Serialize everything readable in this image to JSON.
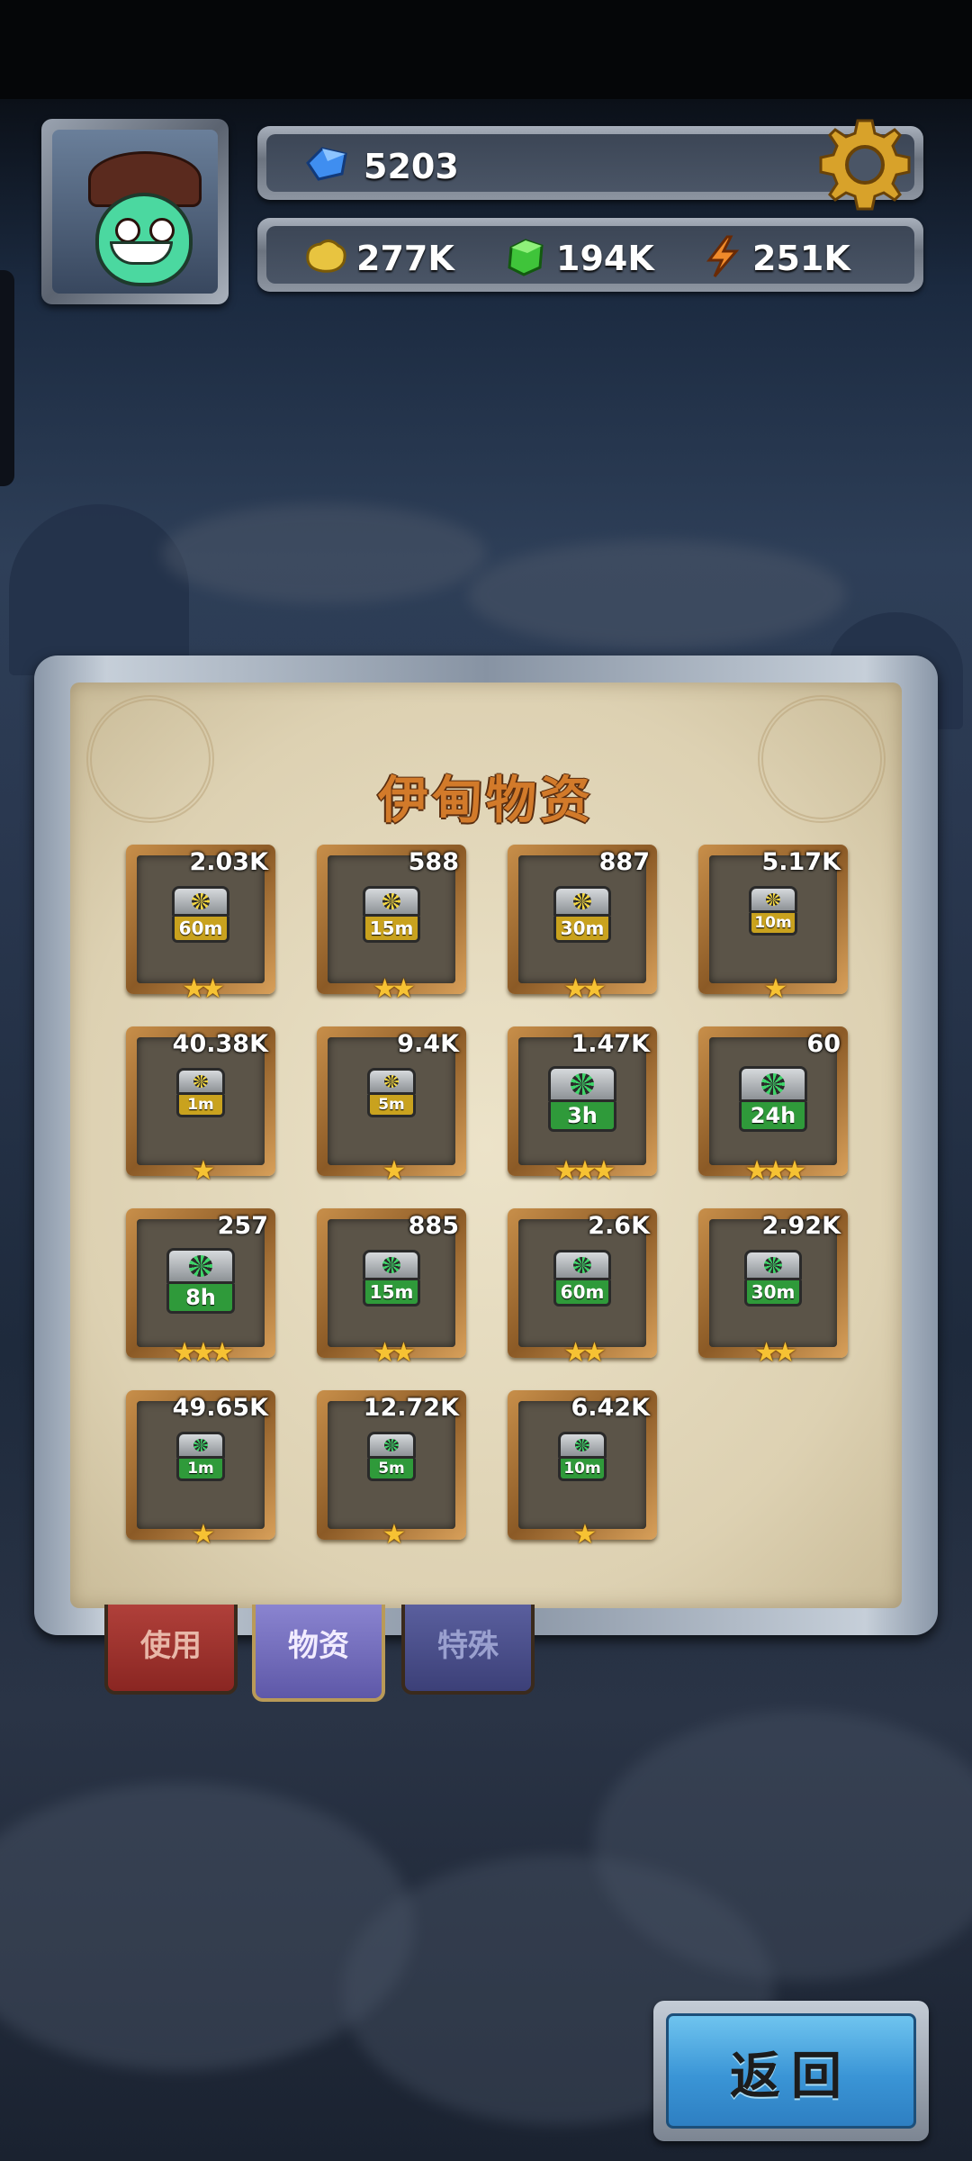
{
  "hud": {
    "gems": "5203",
    "gold": "277K",
    "crystal": "194K",
    "energy": "251K"
  },
  "panel": {
    "title": "伊甸物资"
  },
  "items": [
    {
      "count": "2.03K",
      "label": "60m",
      "tier": "gold",
      "stars": "★★"
    },
    {
      "count": "588",
      "label": "15m",
      "tier": "gold",
      "stars": "★★"
    },
    {
      "count": "887",
      "label": "30m",
      "tier": "gold",
      "stars": "★★"
    },
    {
      "count": "5.17K",
      "label": "10m",
      "tier": "gold",
      "stars": "★"
    },
    {
      "count": "40.38K",
      "label": "1m",
      "tier": "gold",
      "stars": "★"
    },
    {
      "count": "9.4K",
      "label": "5m",
      "tier": "gold",
      "stars": "★"
    },
    {
      "count": "1.47K",
      "label": "3h",
      "tier": "green",
      "stars": "★★★"
    },
    {
      "count": "60",
      "label": "24h",
      "tier": "green",
      "stars": "★★★"
    },
    {
      "count": "257",
      "label": "8h",
      "tier": "green",
      "stars": "★★★"
    },
    {
      "count": "885",
      "label": "15m",
      "tier": "green",
      "stars": "★★"
    },
    {
      "count": "2.6K",
      "label": "60m",
      "tier": "green",
      "stars": "★★"
    },
    {
      "count": "2.92K",
      "label": "30m",
      "tier": "green",
      "stars": "★★"
    },
    {
      "count": "49.65K",
      "label": "1m",
      "tier": "green",
      "stars": "★"
    },
    {
      "count": "12.72K",
      "label": "5m",
      "tier": "green",
      "stars": "★"
    },
    {
      "count": "6.42K",
      "label": "10m",
      "tier": "green",
      "stars": "★"
    }
  ],
  "tabs": {
    "use": "使用",
    "supplies": "物资",
    "special": "特殊"
  },
  "buttons": {
    "back": "返回"
  },
  "colors": {
    "gold_box": "#c9a21e",
    "green_box": "#2f9a3a",
    "tab_use": "#9a2e2a",
    "tab_supplies": "#6e68b8",
    "tab_special": "#4a4f88",
    "back_button": "#3a95d6"
  }
}
